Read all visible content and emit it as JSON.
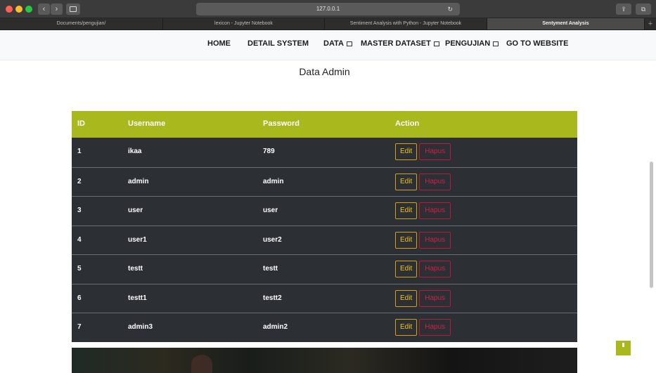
{
  "browser": {
    "url": "127.0.0.1",
    "nav_back": "‹",
    "nav_forward": "›",
    "reload": "↻",
    "share": "⇪",
    "tabs_overview": "⧉",
    "tabs": [
      {
        "title": "Documents/pengujian/"
      },
      {
        "title": "lexicon - Jupyter Notebook"
      },
      {
        "title": "Sentiment Analysis with Python - Jupyter Notebook"
      },
      {
        "title": "Sentyment Analysis"
      }
    ],
    "new_tab": "+"
  },
  "site_nav": {
    "home": "HOME",
    "detail_system": "DETAIL SYSTEM",
    "data": "DATA",
    "master_dataset": "MASTER DATASET",
    "pengujian": "PENGUJIAN",
    "go_to_website": "GO TO WEBSITE"
  },
  "page": {
    "title": "Data Admin"
  },
  "table": {
    "headers": {
      "id": "ID",
      "username": "Username",
      "password": "Password",
      "action": "Action"
    },
    "edit_label": "Edit",
    "delete_label": "Hapus",
    "rows": [
      {
        "id": "1",
        "username": "ikaa",
        "password": "789"
      },
      {
        "id": "2",
        "username": "admin",
        "password": "admin"
      },
      {
        "id": "3",
        "username": "user",
        "password": "user"
      },
      {
        "id": "4",
        "username": "user1",
        "password": "user2"
      },
      {
        "id": "5",
        "username": "testt",
        "password": "testt"
      },
      {
        "id": "6",
        "username": "testt1",
        "password": "testt2"
      },
      {
        "id": "7",
        "username": "admin3",
        "password": "admin2"
      }
    ]
  },
  "colors": {
    "accent": "#a8b81d",
    "table_row": "#2c3035",
    "edit": "#f0c419",
    "delete": "#d21e45"
  }
}
